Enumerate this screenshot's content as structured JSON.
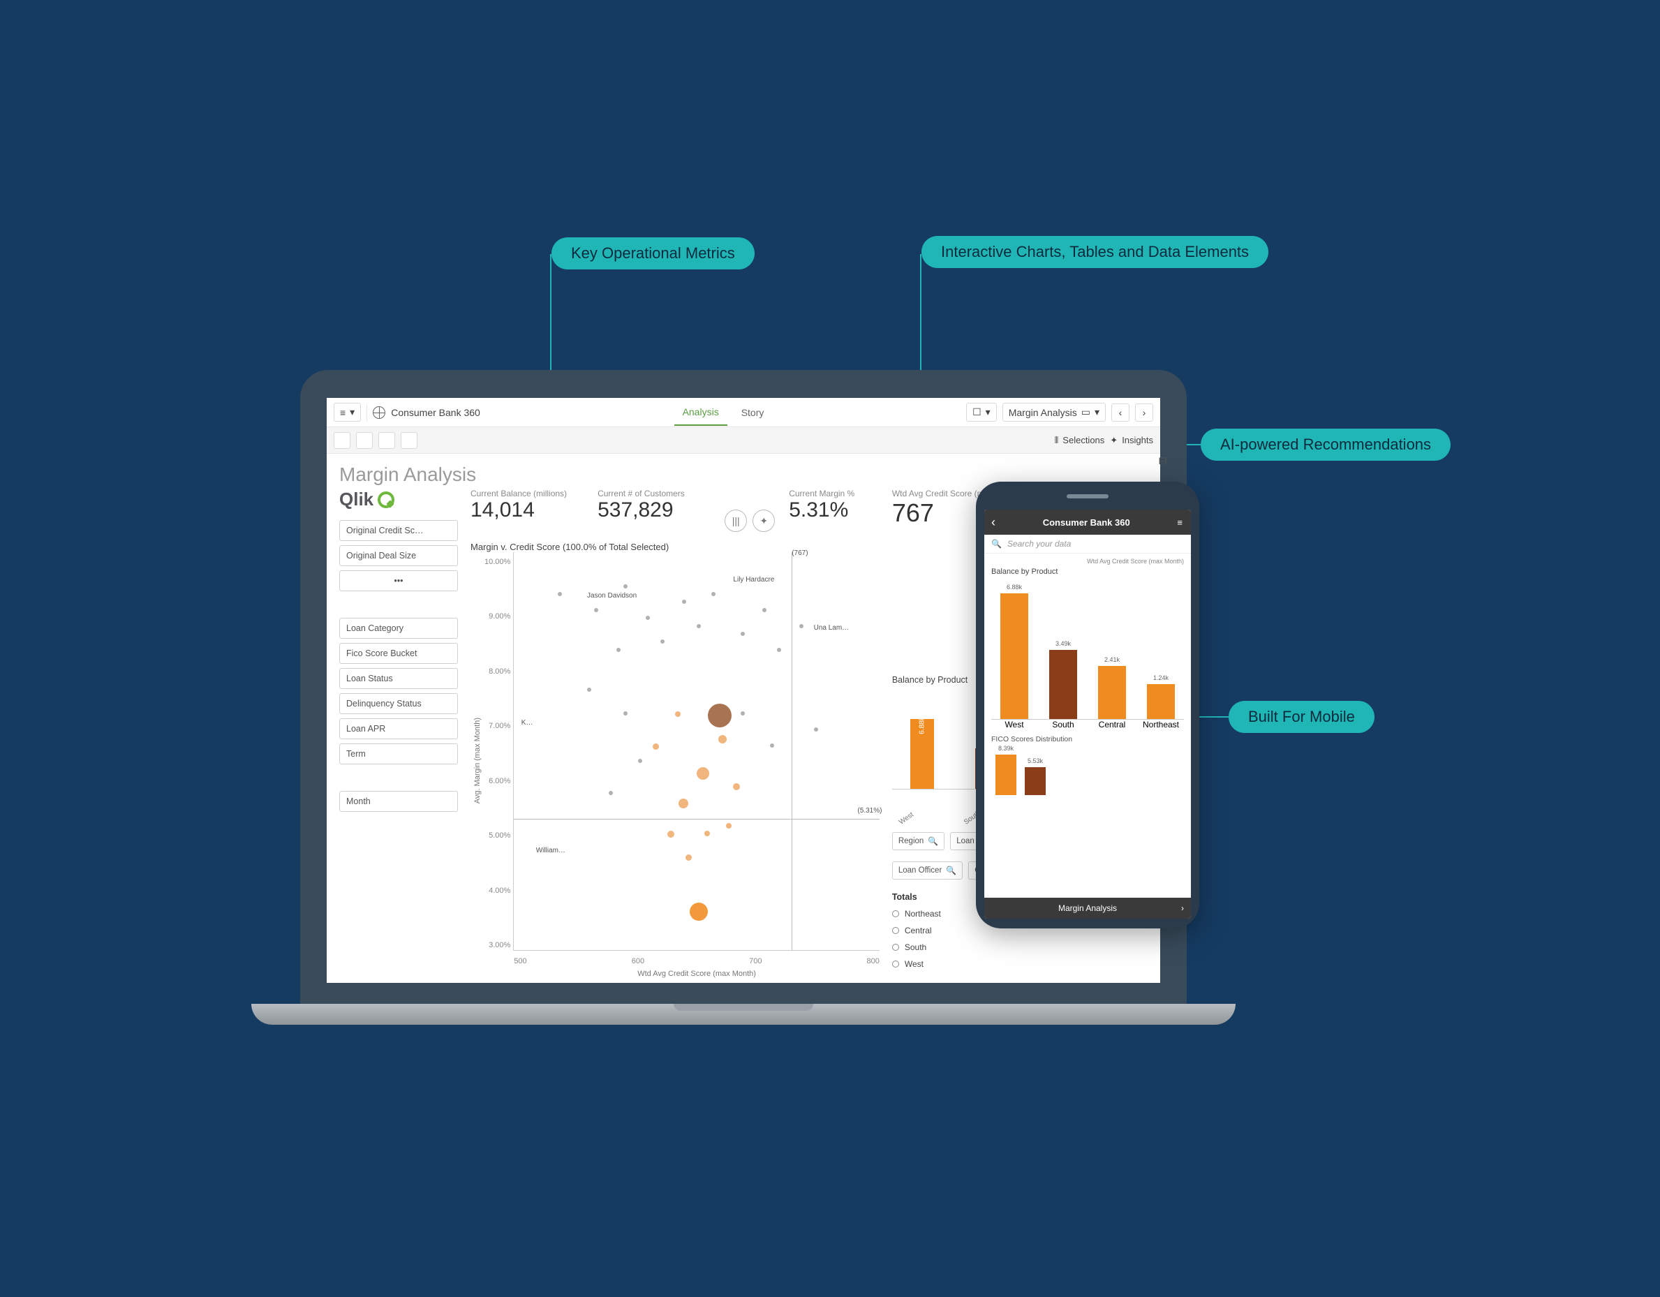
{
  "callouts": {
    "metrics": "Key Operational Metrics",
    "charts": "Interactive Charts, Tables and Data Elements",
    "ai": "AI-powered Recommendations",
    "mobile": "Built For Mobile"
  },
  "app": {
    "brand": "Qlik",
    "title": "Consumer Bank 360",
    "tabs": {
      "analysis": "Analysis",
      "story": "Story"
    },
    "sheet_picker": "Margin Analysis",
    "secondary": {
      "selections": "Selections",
      "insights": "Insights"
    },
    "page_title": "Margin Analysis"
  },
  "kpis": [
    {
      "label": "Current Balance (millions)",
      "value": "14,014"
    },
    {
      "label": "Current # of Customers",
      "value": "537,829"
    },
    {
      "label": "Current Margin %",
      "value": "5.31%"
    },
    {
      "label": "Wtd Avg Credit Score (max Mont…",
      "value": "767"
    }
  ],
  "filters": {
    "group1": [
      "Original Credit Sc…",
      "Original Deal Size",
      "•••"
    ],
    "group2": [
      "Loan Category",
      "Fico Score Bucket",
      "Loan Status",
      "Delinquency Status",
      "Loan APR",
      "Term"
    ],
    "group3": [
      "Month"
    ]
  },
  "scatter": {
    "title": "Margin v. Credit Score (100.0% of Total Selected)",
    "ylabel": "Avg. Margin (max Month)",
    "xlabel": "Wtd Avg Credit Score (max Month)",
    "xticks": [
      "500",
      "600",
      "700",
      "800"
    ],
    "yticks": [
      "10.00%",
      "9.00%",
      "8.00%",
      "7.00%",
      "6.00%",
      "5.00%",
      "4.00%",
      "3.00%"
    ],
    "annotations": [
      "(767)",
      "Jason Davidson",
      "Lily Hardacre",
      "Una Lam…",
      "K…",
      "(5.31%)",
      "William…"
    ],
    "xref": 767,
    "yref": 5.31
  },
  "balance_chart": {
    "title": "Balance by Product",
    "bars": [
      {
        "cat": "West",
        "value": "6.88k",
        "h": 100,
        "style": "orange"
      },
      {
        "cat": "South",
        "value": "3.49k",
        "h": 58,
        "style": "darkred"
      },
      {
        "cat": "Central",
        "value": "2.41k",
        "h": 44,
        "style": "orange"
      },
      {
        "cat": "Nort…",
        "value": "1.24k",
        "h": 30,
        "style": "orange"
      }
    ]
  },
  "chips": [
    "Region",
    "Loan Product Ca…",
    "Loan Officer",
    "CustomerID"
  ],
  "totals": {
    "title": "Totals",
    "rows": [
      "Northeast",
      "Central",
      "South",
      "West"
    ]
  },
  "extra_kpi_prefix": "FI",
  "phone": {
    "title": "Consumer Bank 360",
    "search_placeholder": "Search your data",
    "wtd_label": "Wtd Avg Credit Score (max Month)",
    "balance_title": "Balance by Product",
    "bars": [
      {
        "cat": "West",
        "value": "6.88k",
        "h": 100,
        "style": "orange"
      },
      {
        "cat": "South",
        "value": "3.49k",
        "h": 55,
        "style": "darkred"
      },
      {
        "cat": "Central",
        "value": "2.41k",
        "h": 42,
        "style": "orange"
      },
      {
        "cat": "Northeast",
        "value": "1.24k",
        "h": 28,
        "style": "orange"
      }
    ],
    "fico_title": "FICO Scores Distribution",
    "fico_bars": [
      {
        "value": "8.39k",
        "h": 58,
        "style": "orange"
      },
      {
        "value": "5.53k",
        "h": 40,
        "style": "darkred"
      }
    ],
    "footer": "Margin Analysis"
  },
  "colors": {
    "teal": "#21b6b6",
    "orange": "#f08c1f",
    "darkred": "#8b3d17"
  },
  "chart_data": [
    {
      "type": "bar",
      "title": "Balance by Product",
      "categories": [
        "West",
        "South",
        "Central",
        "Northeast"
      ],
      "values": [
        6880,
        3490,
        2410,
        1240
      ],
      "value_labels": [
        "6.88k",
        "3.49k",
        "2.41k",
        "1.24k"
      ],
      "ylim": [
        0,
        7000
      ]
    },
    {
      "type": "scatter",
      "title": "Margin v. Credit Score (100.0% of Total Selected)",
      "xlabel": "Wtd Avg Credit Score (max Month)",
      "ylabel": "Avg. Margin (max Month)",
      "xlim": [
        500,
        850
      ],
      "ylim": [
        3.0,
        10.0
      ],
      "reference_lines": {
        "x": 767,
        "y": 5.31
      },
      "annotations": [
        "Jason Davidson",
        "Lily Hardacre",
        "Una Lam…",
        "William…",
        "K…"
      ]
    },
    {
      "type": "bar",
      "title": "FICO Scores Distribution",
      "categories": [
        "",
        ""
      ],
      "values": [
        8390,
        5530
      ],
      "value_labels": [
        "8.39k",
        "5.53k"
      ]
    }
  ]
}
